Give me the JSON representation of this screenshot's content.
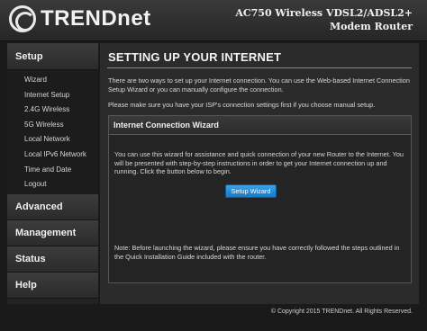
{
  "header": {
    "brand": "TRENDnet",
    "model_line1": "AC750 Wireless VDSL2/ADSL2+",
    "model_line2": "Modem Router"
  },
  "sidebar": {
    "sections": [
      {
        "label": "Setup",
        "items": [
          "Wizard",
          "Internet Setup",
          "2.4G Wireless",
          "5G Wireless",
          "Local Network",
          "Local IPv6 Network",
          "Time and Date",
          "Logout"
        ]
      },
      {
        "label": "Advanced"
      },
      {
        "label": "Management"
      },
      {
        "label": "Status"
      },
      {
        "label": "Help"
      }
    ]
  },
  "main": {
    "title": "SETTING UP YOUR INTERNET",
    "intro": "There are two ways to set up your Internet connection. You can use the Web-based Internet Connection Setup Wizard or you can manually configure the connection.",
    "intro2": "Please make sure you have your ISP's connection settings first if you choose manual setup.",
    "panel": {
      "title": "Internet Connection Wizard",
      "text": "You can use this wizard for assistance and quick connection of your new Router to the Internet. You will be presented with step-by-step instructions in order to get your Internet connection up and running. Click the button below to begin.",
      "button_label": "Setup Wizard",
      "note": "Note: Before launching the wizard, please ensure you have correctly followed the steps outlined in the Quick Installation Guide included with the router."
    }
  },
  "footer": {
    "copyright": "© Copyright 2015 TRENDnet. All Rights Reserved."
  }
}
